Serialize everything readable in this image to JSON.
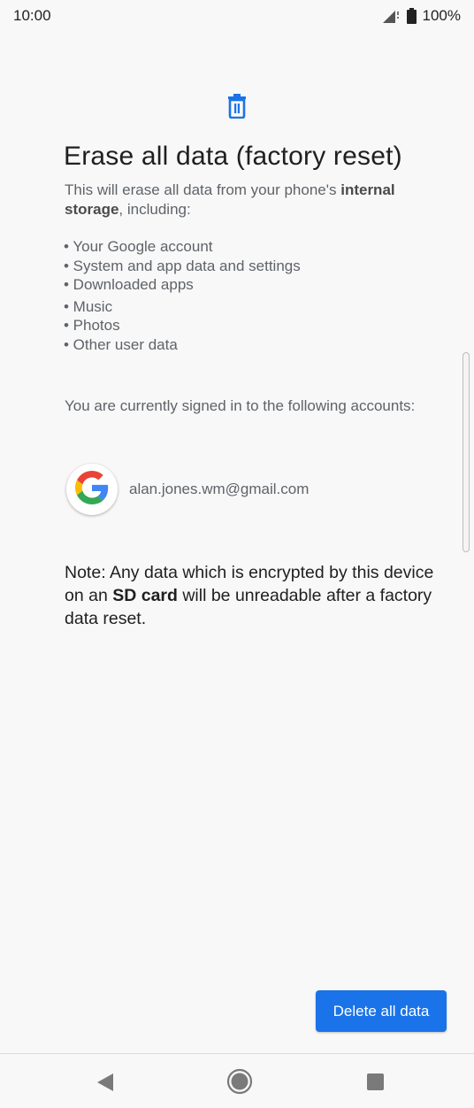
{
  "status_bar": {
    "time": "10:00",
    "battery": "100%"
  },
  "page": {
    "title": "Erase all data (factory reset)",
    "intro_before": "This will erase all data from your phone's ",
    "intro_bold": "internal storage",
    "intro_after": ", including:",
    "items": [
      "• Your Google account",
      "• System and app data and settings",
      "• Downloaded apps",
      "• Music",
      "• Photos",
      "• Other user data"
    ],
    "signed_in_text": "You are currently signed in to the following accounts:",
    "account_email": "alan.jones.wm@gmail.com",
    "note_before": "Note: Any data which is encrypted by this device on an ",
    "note_bold": "SD card",
    "note_after": " will be unreadable after a factory data reset."
  },
  "delete_button_label": "Delete all data",
  "colors": {
    "accent": "#1a73e8",
    "text_secondary": "#5f6368",
    "background": "#f8f8f8"
  },
  "icons": [
    "trash-icon",
    "google-icon",
    "signal-icon",
    "battery-icon",
    "back-icon",
    "home-icon",
    "recents-icon"
  ]
}
